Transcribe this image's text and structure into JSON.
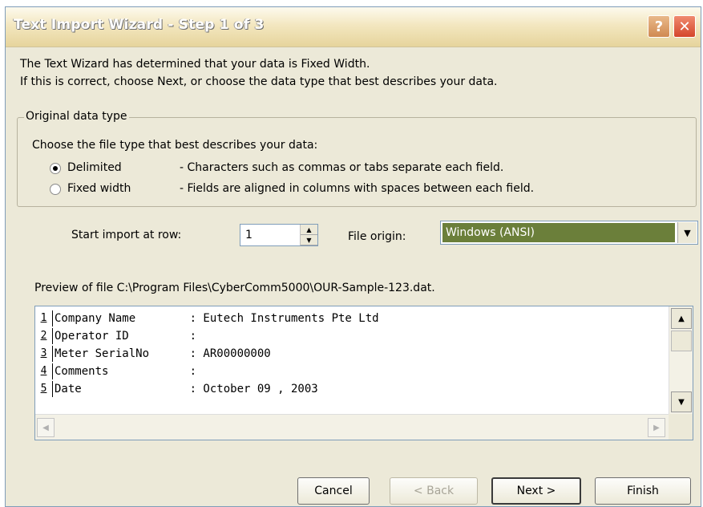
{
  "window": {
    "title": "Text Import Wizard - Step 1 of 3"
  },
  "titlebar_buttons": {
    "help": "?",
    "close": "✕"
  },
  "intro": {
    "line1": "The Text Wizard has determined that your data is Fixed Width.",
    "line2": "If this is correct, choose Next, or choose the data type that best describes your data."
  },
  "group": {
    "legend": "Original data type",
    "prompt": "Choose the file type that best describes your data:",
    "options": [
      {
        "label": "Delimited",
        "desc": "- Characters such as commas or tabs separate each field.",
        "selected": true
      },
      {
        "label": "Fixed width",
        "desc": "- Fields are aligned in columns with spaces between each field.",
        "selected": false
      }
    ]
  },
  "import": {
    "start_row_label": "Start import at row:",
    "start_row_value": "1",
    "file_origin_label": "File origin:",
    "file_origin_value": "Windows (ANSI)"
  },
  "preview": {
    "label": "Preview of file C:\\Program Files\\CyberComm5000\\OUR-Sample-123.dat.",
    "rows": [
      {
        "num": "1",
        "text": "Company Name        : Eutech Instruments Pte Ltd"
      },
      {
        "num": "2",
        "text": "Operator ID         :"
      },
      {
        "num": "3",
        "text": "Meter SerialNo      : AR00000000"
      },
      {
        "num": "4",
        "text": "Comments            :"
      },
      {
        "num": "5",
        "text": "Date                : October 09 , 2003"
      }
    ]
  },
  "buttons": {
    "cancel": "Cancel",
    "back": "< Back",
    "next": "Next >",
    "finish": "Finish"
  },
  "colors": {
    "dialog_bg": "#ECE9D8",
    "selection": "#6b7f3a",
    "border": "#7f9db9"
  },
  "icons": [
    "help-icon",
    "close-icon",
    "spin-up-icon",
    "spin-down-icon",
    "dropdown-arrow-icon",
    "scroll-up-icon",
    "scroll-down-icon",
    "scroll-left-icon",
    "scroll-right-icon"
  ]
}
